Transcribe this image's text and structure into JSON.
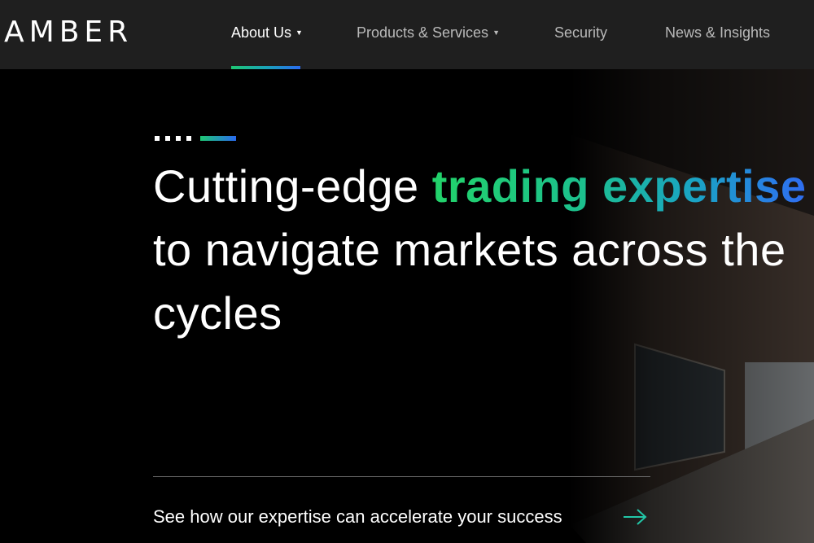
{
  "brand": {
    "logo_text": "AMBER"
  },
  "nav": {
    "items": [
      {
        "label": "About Us",
        "has_dropdown": true,
        "active": true
      },
      {
        "label": "Products & Services",
        "has_dropdown": true,
        "active": false
      },
      {
        "label": "Security",
        "has_dropdown": false,
        "active": false
      },
      {
        "label": "News & Insights",
        "has_dropdown": false,
        "active": false
      }
    ],
    "caret_glyph": "▼"
  },
  "hero": {
    "headline_prefix": "Cutting-edge ",
    "headline_accent": "trading expertise",
    "headline_rest": "to navigate markets across the cycles",
    "cta_text": "See how our expertise can accelerate your success",
    "cta_icon": "arrow-right-icon"
  },
  "colors": {
    "nav_bg": "#1f1f1f",
    "accent_green": "#1ec773",
    "accent_blue": "#2a6bf0",
    "nav_text": "#b9b9b9",
    "nav_text_active": "#ffffff",
    "cta_arrow": "#22c7a8"
  }
}
